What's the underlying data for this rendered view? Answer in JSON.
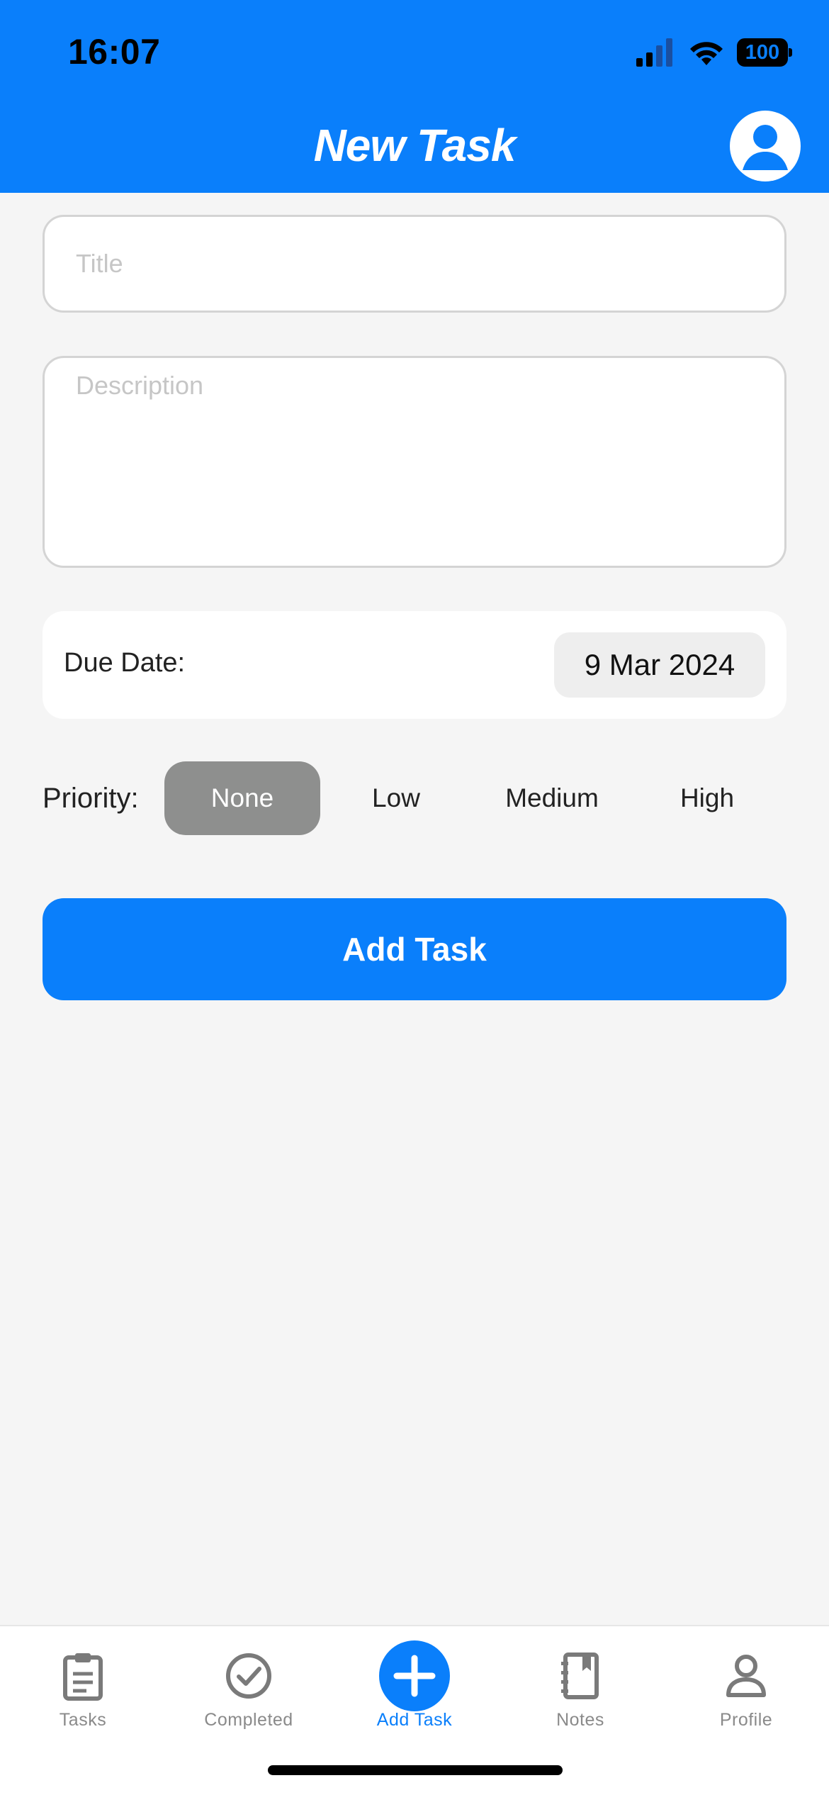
{
  "status_bar": {
    "time": "16:07",
    "battery": "100"
  },
  "header": {
    "title": "New Task"
  },
  "form": {
    "title_placeholder": "Title",
    "description_placeholder": "Description",
    "due_date_label": "Due Date:",
    "due_date_value": "9 Mar 2024",
    "priority_label": "Priority:",
    "priority_options": [
      "None",
      "Low",
      "Medium",
      "High"
    ],
    "priority_selected": "None",
    "submit_label": "Add Task"
  },
  "tabbar": {
    "items": [
      {
        "label": "Tasks",
        "icon": "clipboard-icon"
      },
      {
        "label": "Completed",
        "icon": "checkmark-circle-icon"
      },
      {
        "label": "Add Task",
        "icon": "plus-circle-icon"
      },
      {
        "label": "Notes",
        "icon": "notebook-icon"
      },
      {
        "label": "Profile",
        "icon": "person-icon"
      }
    ],
    "active": "Add Task"
  },
  "colors": {
    "accent": "#0a7ffb",
    "selected_priority_bg": "#8e8f8e",
    "inactive_tab": "#8a8a8a",
    "background": "#f5f5f5"
  }
}
